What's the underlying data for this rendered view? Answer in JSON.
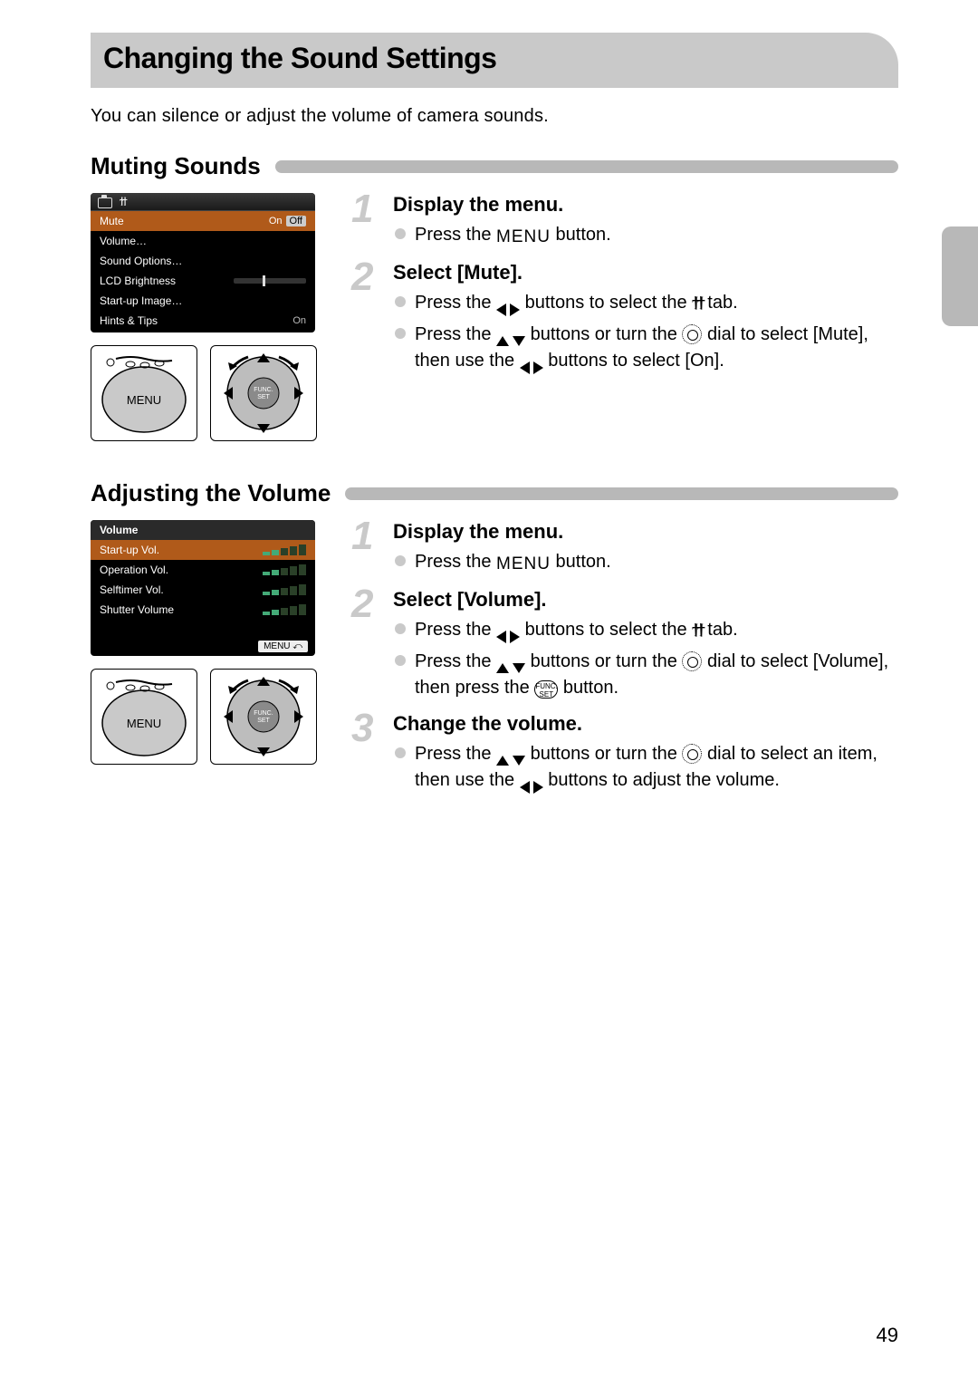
{
  "page_number": "49",
  "title": "Changing the Sound Settings",
  "intro": "You can silence or adjust the volume of camera sounds.",
  "sections": {
    "muting": {
      "heading": "Muting Sounds",
      "menu_items": [
        {
          "label": "Mute",
          "value_on": "On",
          "value_off": "Off",
          "selected": true
        },
        {
          "label": "Volume…",
          "value": ""
        },
        {
          "label": "Sound Options…",
          "value": ""
        },
        {
          "label": "LCD Brightness",
          "value": "slider"
        },
        {
          "label": "Start-up Image…",
          "value": ""
        },
        {
          "label": "Hints & Tips",
          "value": "On"
        }
      ],
      "steps": [
        {
          "num": "1",
          "title": "Display the menu.",
          "bullets": [
            {
              "parts": [
                "Press the ",
                {
                  "icon": "menu"
                },
                " button."
              ]
            }
          ]
        },
        {
          "num": "2",
          "title": "Select [Mute].",
          "bullets": [
            {
              "parts": [
                "Press the ",
                {
                  "icon": "lr"
                },
                " buttons to select the ",
                {
                  "icon": "tools"
                },
                " tab."
              ]
            },
            {
              "parts": [
                "Press the ",
                {
                  "icon": "ud"
                },
                " buttons or turn the ",
                {
                  "icon": "dial"
                },
                " dial to select [Mute], then use the ",
                {
                  "icon": "lr"
                },
                " buttons to select [On]."
              ]
            }
          ]
        }
      ]
    },
    "volume": {
      "heading": "Adjusting the Volume",
      "menu_title": "Volume",
      "menu_items": [
        {
          "label": "Start-up Vol.",
          "level": 2,
          "selected": true
        },
        {
          "label": "Operation Vol.",
          "level": 2
        },
        {
          "label": "Selftimer Vol.",
          "level": 2
        },
        {
          "label": "Shutter Volume",
          "level": 2
        }
      ],
      "menu_footer": "MENU",
      "steps": [
        {
          "num": "1",
          "title": "Display the menu.",
          "bullets": [
            {
              "parts": [
                "Press the ",
                {
                  "icon": "menu"
                },
                " button."
              ]
            }
          ]
        },
        {
          "num": "2",
          "title": "Select [Volume].",
          "bullets": [
            {
              "parts": [
                "Press the ",
                {
                  "icon": "lr"
                },
                " buttons to select the ",
                {
                  "icon": "tools"
                },
                " tab."
              ]
            },
            {
              "parts": [
                "Press the ",
                {
                  "icon": "ud"
                },
                " buttons or turn the ",
                {
                  "icon": "dial"
                },
                " dial to select [Volume], then press the ",
                {
                  "icon": "func"
                },
                " button."
              ]
            }
          ]
        },
        {
          "num": "3",
          "title": "Change the volume.",
          "bullets": [
            {
              "parts": [
                "Press the ",
                {
                  "icon": "ud"
                },
                " buttons or turn the ",
                {
                  "icon": "dial"
                },
                " dial to select an item, then use the ",
                {
                  "icon": "lr"
                },
                " buttons to adjust the volume."
              ]
            }
          ]
        }
      ]
    }
  },
  "icons": {
    "menu_label": "MENU",
    "tools_label": "ϯϯ",
    "func_top": "FUNC.",
    "func_bottom": "SET"
  }
}
